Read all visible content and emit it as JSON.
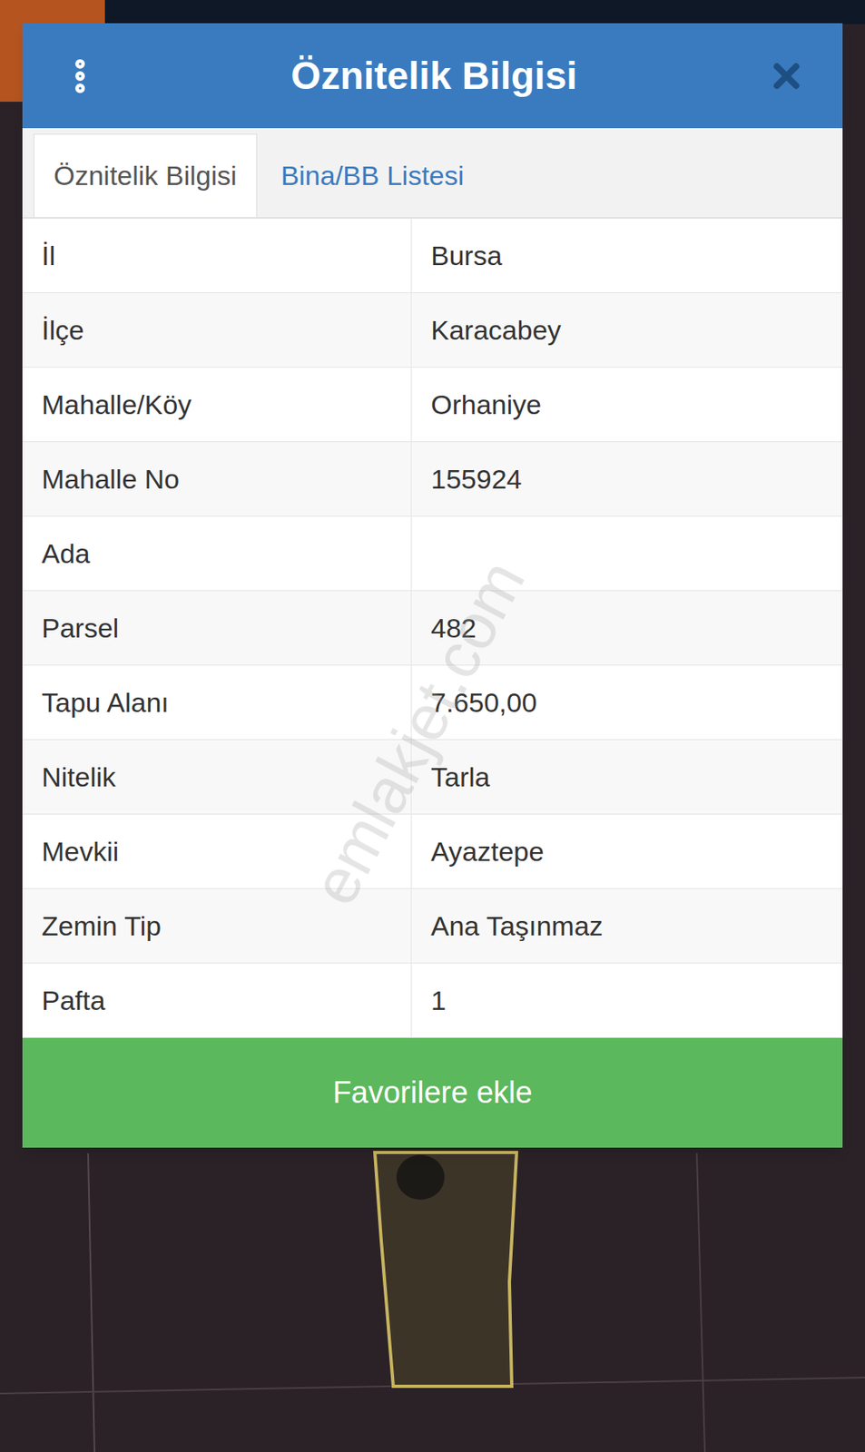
{
  "window": {
    "title": "Öznitelik Bilgisi"
  },
  "tabs": [
    {
      "label": "Öznitelik Bilgisi",
      "selected": true
    },
    {
      "label": "Bina/BB Listesi",
      "selected": false
    }
  ],
  "rows": [
    {
      "label": "İl",
      "value": "Bursa"
    },
    {
      "label": "İlçe",
      "value": "Karacabey"
    },
    {
      "label": "Mahalle/Köy",
      "value": "Orhaniye"
    },
    {
      "label": "Mahalle No",
      "value": "155924"
    },
    {
      "label": "Ada",
      "value": ""
    },
    {
      "label": "Parsel",
      "value": "482"
    },
    {
      "label": "Tapu Alanı",
      "value": "7.650,00"
    },
    {
      "label": "Nitelik",
      "value": "Tarla"
    },
    {
      "label": "Mevkii",
      "value": "Ayaztepe"
    },
    {
      "label": "Zemin Tip",
      "value": "Ana Taşınmaz"
    },
    {
      "label": "Pafta",
      "value": "1"
    }
  ],
  "button": "Favorilere ekle",
  "watermark": "emlakjet.com"
}
